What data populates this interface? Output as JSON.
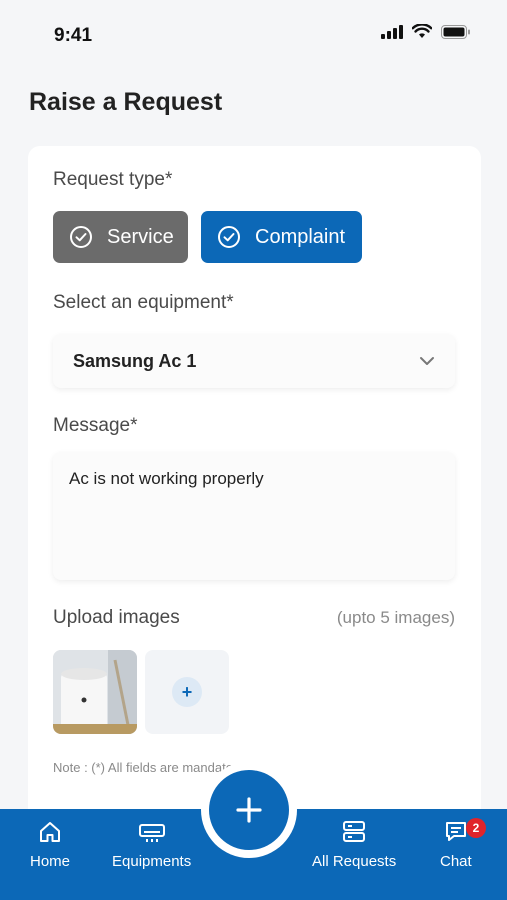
{
  "status_bar": {
    "time": "9:41"
  },
  "page": {
    "title": "Raise a Request"
  },
  "form": {
    "request_type_label": "Request type*",
    "request_types": [
      {
        "label": "Service",
        "selected": false,
        "color": "#6b6b6b"
      },
      {
        "label": "Complaint",
        "selected": true,
        "color": "#0c68b7"
      }
    ],
    "equipment_label": "Select an equipment*",
    "equipment_value": "Samsung Ac 1",
    "message_label": "Message*",
    "message_value": "Ac is not working properly",
    "upload_label": "Upload images",
    "upload_hint": "(upto 5 images)",
    "add_image_symbol": "+",
    "note": "Note : (*) All fields are mandatory."
  },
  "bottom_nav": {
    "items": [
      {
        "label": "Home",
        "icon": "home-icon"
      },
      {
        "label": "Equipments",
        "icon": "air-conditioner-icon"
      },
      {
        "label": "All Requests",
        "icon": "server-list-icon"
      },
      {
        "label": "Chat",
        "icon": "chat-icon"
      }
    ],
    "chat_badge": "2",
    "fab_icon": "plus-icon"
  },
  "colors": {
    "accent": "#0c68b7",
    "badge": "#e0242b",
    "inactive_button": "#6b6b6b"
  }
}
